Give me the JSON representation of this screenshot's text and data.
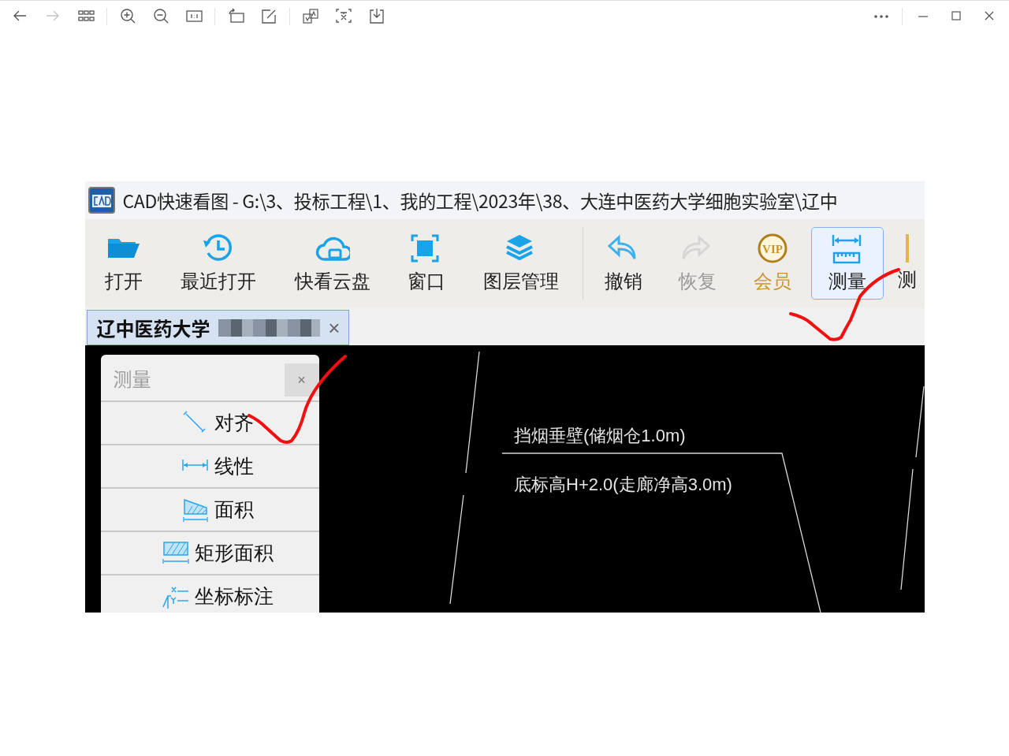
{
  "viewer_toolbar": {
    "left_buttons": [
      {
        "kind": "back",
        "disabled": false
      },
      {
        "kind": "forward",
        "disabled": true
      },
      {
        "kind": "grid",
        "disabled": false
      },
      {
        "kind": "zoom-in",
        "disabled": false
      },
      {
        "kind": "zoom-out",
        "disabled": false
      },
      {
        "kind": "actual-size",
        "disabled": false
      },
      {
        "kind": "rotate",
        "disabled": false
      },
      {
        "kind": "edit",
        "disabled": false
      },
      {
        "kind": "translate",
        "disabled": false
      },
      {
        "kind": "text-scan",
        "disabled": false
      },
      {
        "kind": "save",
        "disabled": false
      }
    ],
    "right_buttons": [
      {
        "kind": "more"
      },
      {
        "kind": "minimize"
      },
      {
        "kind": "maximize"
      },
      {
        "kind": "close"
      }
    ]
  },
  "screenshot": {
    "window_title": "CAD快速看图 - G:\\3、投标工程\\1、我的工程\\2023年\\38、大连中医药大学细胞实验室\\辽中",
    "toolbar": [
      {
        "kind": "open",
        "label": "打开",
        "disabled": false,
        "selected": false
      },
      {
        "kind": "recent",
        "label": "最近打开",
        "disabled": false,
        "selected": false
      },
      {
        "kind": "cloud",
        "label": "快看云盘",
        "disabled": false,
        "selected": false
      },
      {
        "kind": "window",
        "label": "窗口",
        "disabled": false,
        "selected": false
      },
      {
        "kind": "layers",
        "label": "图层管理",
        "disabled": false,
        "selected": false
      },
      {
        "kind": "separator"
      },
      {
        "kind": "undo",
        "label": "撤销",
        "disabled": false,
        "selected": false
      },
      {
        "kind": "redo",
        "label": "恢复",
        "disabled": true,
        "selected": false
      },
      {
        "kind": "vip",
        "label": "会员",
        "icon_text": "VIP",
        "disabled": false,
        "selected": false
      },
      {
        "kind": "measure",
        "label": "测量",
        "disabled": false,
        "selected": true
      },
      {
        "kind": "partial",
        "label": "测",
        "disabled": false,
        "selected": false
      }
    ],
    "document_tab": {
      "label": "辽中医药大学",
      "close": "×"
    },
    "measure_panel": {
      "title": "测量",
      "close": "×",
      "items": [
        {
          "kind": "aligned",
          "label": "对齐"
        },
        {
          "kind": "linear",
          "label": "线性"
        },
        {
          "kind": "area",
          "label": "面积"
        },
        {
          "kind": "rect-area",
          "label": "矩形面积"
        },
        {
          "kind": "coordinate",
          "label": "坐标标注"
        }
      ]
    },
    "drawing_texts": [
      "挡烟垂壁(储烟仓1.0m)",
      "底标高H+2.0(走廊净高3.0m)"
    ]
  }
}
